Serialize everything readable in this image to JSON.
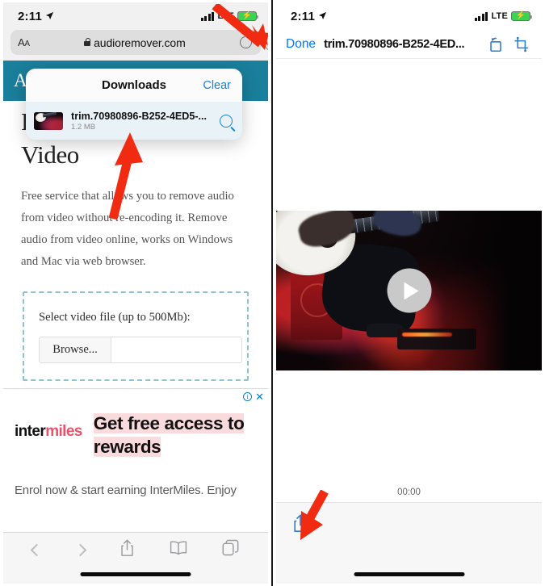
{
  "left_phone": {
    "status_bar": {
      "time": "2:11",
      "location_icon": "location-arrow-icon",
      "network": "LTE",
      "battery_state": "charging"
    },
    "browser": {
      "text_size_label": "AA",
      "url": "audioremover.com",
      "secure_icon": "lock-icon",
      "reload_icon": "reload-icon",
      "downloads_icon": "download-arrow-icon"
    },
    "downloads_popup": {
      "title": "Downloads",
      "clear_label": "Clear",
      "item": {
        "filename": "trim.70980896-B252-4ED5-...",
        "size": "1.2 MB",
        "search_icon": "magnifier-icon"
      }
    },
    "site": {
      "header_text": "Au",
      "header_color": "#1a7f9c",
      "h1": "Remove Audio from Video",
      "paragraph": "Free service that allows you to remove audio from video without re-encoding it. Remove audio from video online, works on Windows and Mac via web browser.",
      "upload": {
        "label": "Select video file (up to 500Mb):",
        "browse_label": "Browse...",
        "file_value": ""
      }
    },
    "ad": {
      "info_icon": "ad-info-icon",
      "close_icon": "ad-close-icon",
      "logo_dark": "inter",
      "logo_accent": "miles",
      "headline_line1": "Get free access to",
      "headline_line2": "rewards",
      "subtext": "Enrol now & start earning InterMiles. Enjoy",
      "accent_color": "#e8536b",
      "highlight_color": "#fadbdd"
    },
    "toolbar": {
      "back_icon": "chevron-left-icon",
      "forward_icon": "chevron-right-icon",
      "share_icon": "share-icon",
      "bookmarks_icon": "book-icon",
      "tabs_icon": "tabs-icon"
    }
  },
  "right_phone": {
    "status_bar": {
      "time": "2:11",
      "location_icon": "location-arrow-icon",
      "network": "LTE",
      "battery_state": "charging"
    },
    "quicklook": {
      "done_label": "Done",
      "filename": "trim.70980896-B252-4ED...",
      "rotate_icon": "rotate-icon",
      "markup_icon": "crop-markup-icon",
      "play_icon": "play-icon",
      "timestamp": "00:00",
      "share_icon": "share-icon",
      "accent_color": "#007aff"
    }
  },
  "annotations": {
    "arrow_color": "#f02b12",
    "arrows": [
      {
        "name": "arrow-to-downloads-button",
        "target": "downloads-button"
      },
      {
        "name": "arrow-to-download-item",
        "target": "download-list-item"
      },
      {
        "name": "arrow-to-share-button",
        "target": "quicklook-share-button"
      }
    ]
  }
}
